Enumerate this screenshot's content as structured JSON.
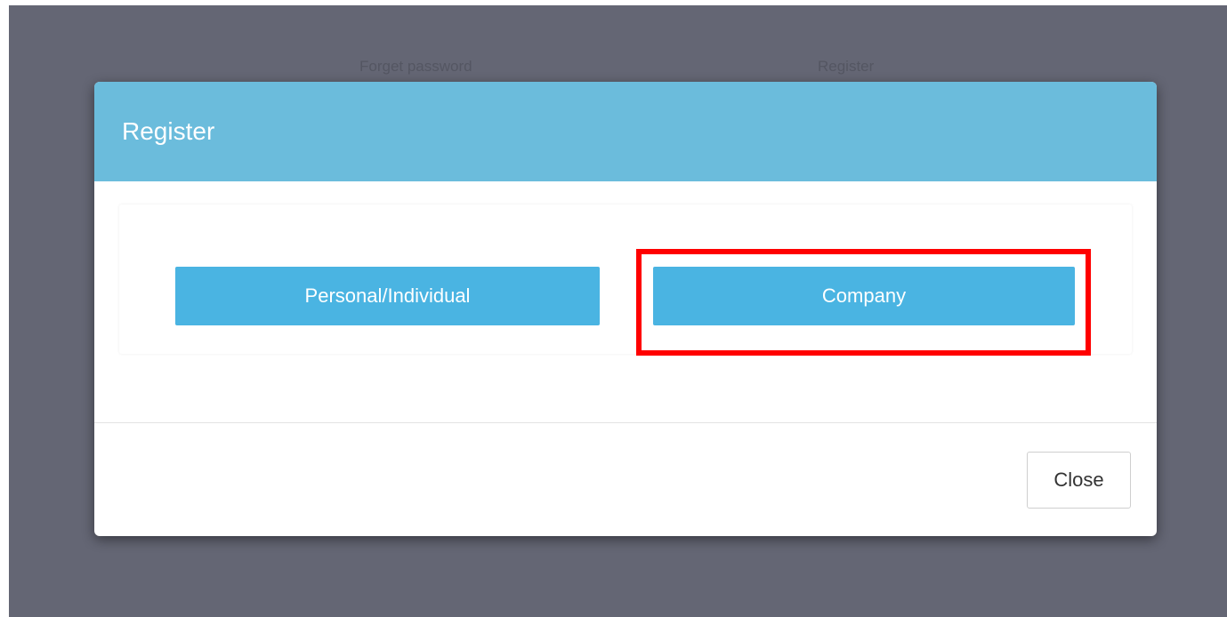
{
  "background": {
    "links": [
      {
        "label": "Forget password"
      },
      {
        "label": "Register"
      }
    ]
  },
  "modal": {
    "title": "Register",
    "options": [
      {
        "label": "Personal/Individual"
      },
      {
        "label": "Company",
        "highlighted": true
      }
    ],
    "close_label": "Close"
  },
  "colors": {
    "backdrop": "#646674",
    "header": "#6bbcdc",
    "button": "#4ab4e2",
    "highlight": "#ff0000"
  }
}
